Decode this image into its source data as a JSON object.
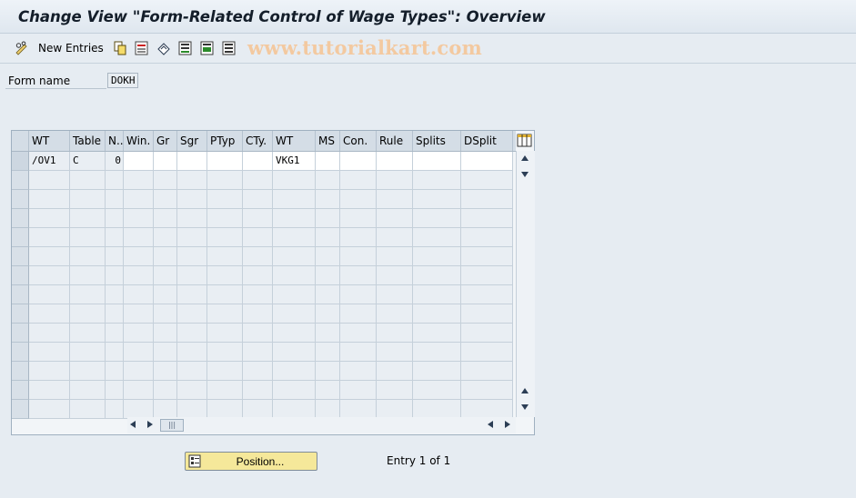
{
  "title": "Change View \"Form-Related Control of Wage Types\": Overview",
  "toolbar": {
    "new_entries_label": "New Entries",
    "icons": [
      "edit-glasses-icon",
      "copy-icon",
      "delete-icon",
      "undo-icon",
      "select-all-icon",
      "select-block-icon",
      "deselect-all-icon"
    ]
  },
  "watermark": "www.tutorialkart.com",
  "form": {
    "label": "Form name",
    "value": "DOKH"
  },
  "table": {
    "headers": [
      "WT",
      "Table",
      "N..",
      "Win.",
      "Gr",
      "Sgr",
      "PTyp",
      "CTy.",
      "WT",
      "MS",
      "Con.",
      "Rule",
      "Splits",
      "DSplit"
    ],
    "rows": [
      [
        "/OV1",
        "C",
        "0",
        "",
        "",
        "",
        "",
        "",
        "VKG1",
        "",
        "",
        "",
        "",
        ""
      ]
    ],
    "empty_rows": 13
  },
  "position_button": "Position...",
  "entry_info": "Entry 1 of 1"
}
